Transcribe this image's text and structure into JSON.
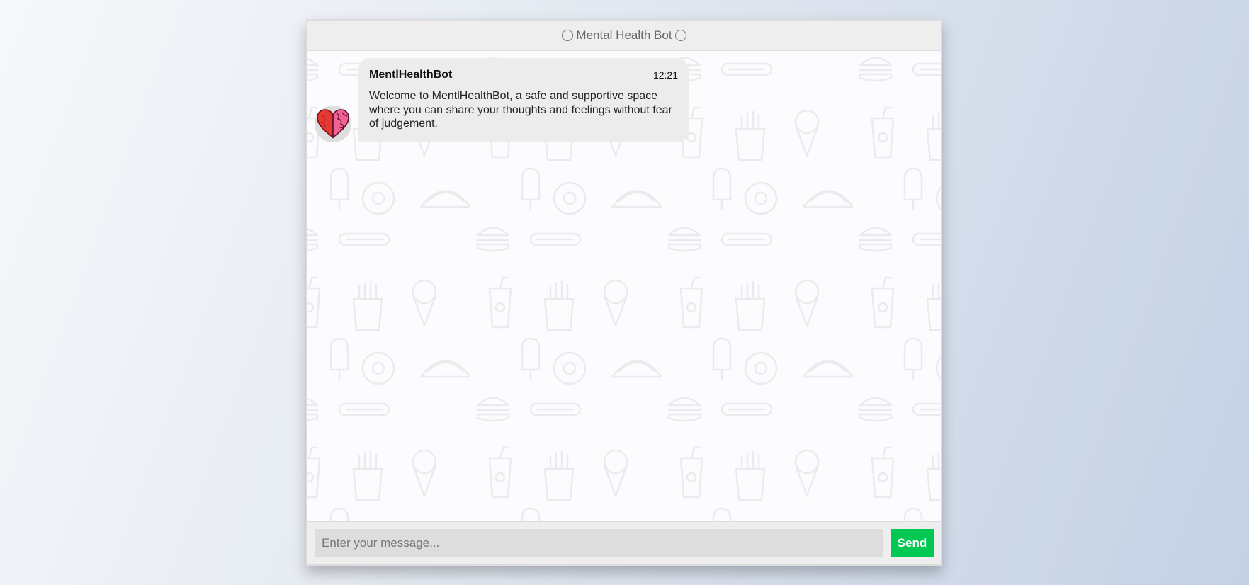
{
  "header": {
    "title": "Mental Health Bot"
  },
  "messages": [
    {
      "name": "MentlHealthBot",
      "time": "12:21",
      "text": "Welcome to MentlHealthBot, a safe and supportive space where you can share your thoughts and feelings without fear of judgement.",
      "avatar_icon": "heart-brain-icon"
    }
  ],
  "composer": {
    "placeholder": "Enter your message...",
    "value": "",
    "send_label": "Send"
  },
  "colors": {
    "send_button": "#00c853",
    "bubble": "#ececec",
    "header": "#eeeeee"
  }
}
